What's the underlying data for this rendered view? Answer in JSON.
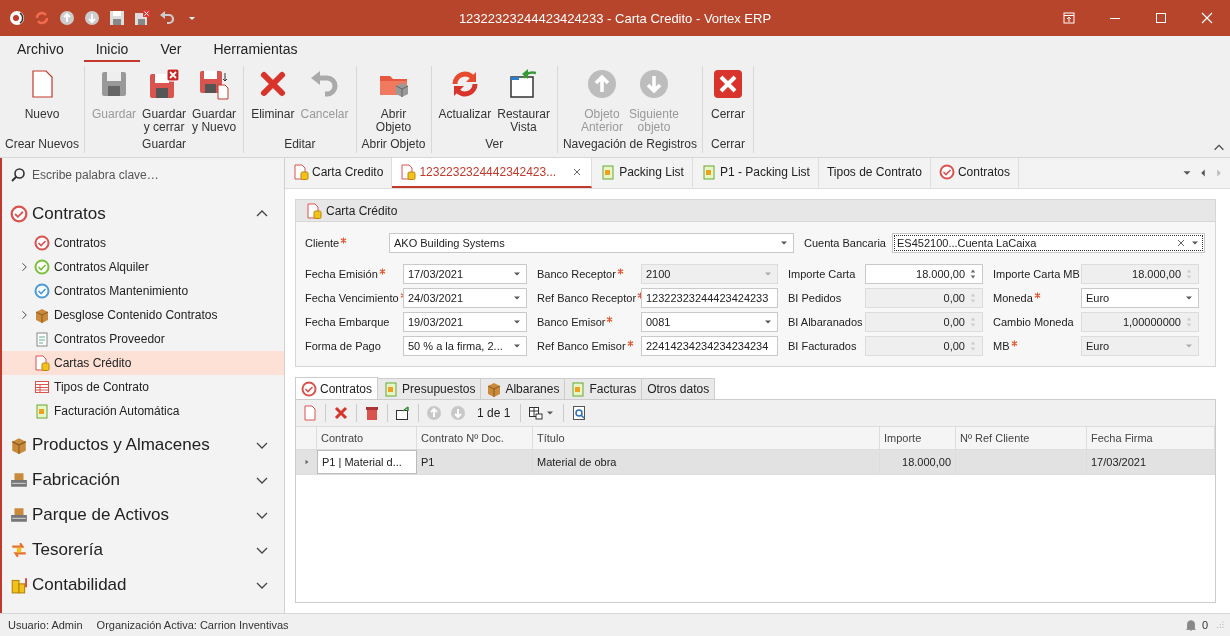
{
  "window": {
    "title": "12322323244423424233 - Carta Credito - Vortex ERP"
  },
  "ribbon": {
    "tabs": [
      {
        "label": "Archivo",
        "selected": false
      },
      {
        "label": "Inicio",
        "selected": true
      },
      {
        "label": "Ver",
        "selected": false
      },
      {
        "label": "Herramientas",
        "selected": false
      }
    ],
    "groups": [
      {
        "label": "Crear Nuevos",
        "buttons": [
          {
            "label": "Nuevo",
            "disabled": false
          }
        ]
      },
      {
        "label": "Guardar",
        "buttons": [
          {
            "label": "Guardar",
            "disabled": true
          },
          {
            "label": "Guardar\ny cerrar",
            "disabled": false
          },
          {
            "label": "Guardar\ny Nuevo",
            "disabled": false
          }
        ]
      },
      {
        "label": "Editar",
        "buttons": [
          {
            "label": "Eliminar",
            "disabled": false
          },
          {
            "label": "Cancelar",
            "disabled": true
          }
        ]
      },
      {
        "label": "Abrir Objeto",
        "buttons": [
          {
            "label": "Abrir\nObjeto",
            "disabled": false
          }
        ]
      },
      {
        "label": "Ver",
        "buttons": [
          {
            "label": "Actualizar",
            "disabled": false
          },
          {
            "label": "Restaurar\nVista",
            "disabled": false
          }
        ]
      },
      {
        "label": "Navegación de Registros",
        "buttons": [
          {
            "label": "Objeto\nAnterior",
            "disabled": true
          },
          {
            "label": "Siguiente\nobjeto",
            "disabled": true
          }
        ]
      },
      {
        "label": "Cerrar",
        "buttons": [
          {
            "label": "Cerrar",
            "disabled": false
          }
        ]
      }
    ]
  },
  "sidebar": {
    "search": {
      "placeholder": "Escribe palabra clave…"
    },
    "sections": [
      {
        "label": "Contratos",
        "expanded": true,
        "items": [
          {
            "label": "Contratos",
            "selected": false,
            "expandable": false
          },
          {
            "label": "Contratos Alquiler",
            "selected": false,
            "expandable": true
          },
          {
            "label": "Contratos Mantenimiento",
            "selected": false,
            "expandable": false
          },
          {
            "label": "Desglose Contenido Contratos",
            "selected": false,
            "expandable": true
          },
          {
            "label": "Contratos Proveedor",
            "selected": false,
            "expandable": false
          },
          {
            "label": "Cartas Crédito",
            "selected": true,
            "expandable": false
          },
          {
            "label": "Tipos de Contrato",
            "selected": false,
            "expandable": false
          },
          {
            "label": "Facturación Automática",
            "selected": false,
            "expandable": false
          }
        ]
      },
      {
        "label": "Productos y Almacenes",
        "expanded": false
      },
      {
        "label": "Fabricación",
        "expanded": false
      },
      {
        "label": "Parque de Activos",
        "expanded": false
      },
      {
        "label": "Tesorería",
        "expanded": false
      },
      {
        "label": "Contabilidad",
        "expanded": false
      }
    ]
  },
  "document_tabs": [
    {
      "label": "Carta Credito",
      "selected": false
    },
    {
      "label": "1232232324442342423...",
      "selected": true
    },
    {
      "label": "Packing List",
      "selected": false
    },
    {
      "label": "P1 - Packing List",
      "selected": false
    },
    {
      "label": "Tipos de Contrato",
      "selected": false
    },
    {
      "label": "Contratos",
      "selected": false
    }
  ],
  "form": {
    "title": "Carta Crédito",
    "top_fields": [
      {
        "label": "Cliente",
        "required": true,
        "value": "AKO Building Systems",
        "kind": "combo",
        "disabled": false,
        "focused": false
      },
      {
        "label": "Cuenta Bancaria",
        "required": false,
        "value": "ES452100...Cuenta LaCaixa",
        "kind": "lookup",
        "disabled": false,
        "focused": true
      }
    ],
    "fields": [
      {
        "label": "Fecha Emisión",
        "required": true,
        "value": "17/03/2021",
        "kind": "combo",
        "disabled": false
      },
      {
        "label": "Banco Receptor",
        "required": true,
        "value": "2100",
        "kind": "combo",
        "disabled": true
      },
      {
        "label": "Importe Carta",
        "required": false,
        "value": "18.000,00",
        "kind": "number",
        "disabled": false
      },
      {
        "label": "Importe Carta MB",
        "required": false,
        "value": "18.000,00",
        "kind": "number",
        "disabled": true
      },
      {
        "label": "Fecha Vencimiento",
        "required": true,
        "value": "24/03/2021",
        "kind": "combo",
        "disabled": false
      },
      {
        "label": "Ref Banco Receptor",
        "required": true,
        "value": "12322323244423424233",
        "kind": "text",
        "disabled": false
      },
      {
        "label": "BI Pedidos",
        "required": false,
        "value": "0,00",
        "kind": "number",
        "disabled": true
      },
      {
        "label": "Moneda",
        "required": true,
        "value": "Euro",
        "kind": "combo",
        "disabled": false
      },
      {
        "label": "Fecha Embarque",
        "required": false,
        "value": "19/03/2021",
        "kind": "combo",
        "disabled": false
      },
      {
        "label": "Banco Emisor",
        "required": true,
        "value": "0081",
        "kind": "combo",
        "disabled": false
      },
      {
        "label": "BI Albaranados",
        "required": false,
        "value": "0,00",
        "kind": "number",
        "disabled": true
      },
      {
        "label": "Cambio Moneda",
        "required": false,
        "value": "1,00000000",
        "kind": "number",
        "disabled": true
      },
      {
        "label": "Forma de Pago",
        "required": false,
        "value": "50 % a la firma, 2...",
        "kind": "combo",
        "disabled": false
      },
      {
        "label": "Ref Banco Emisor",
        "required": true,
        "value": "22414234234234234234",
        "kind": "text",
        "disabled": false
      },
      {
        "label": "BI Facturados",
        "required": false,
        "value": "0,00",
        "kind": "number",
        "disabled": true
      },
      {
        "label": "MB",
        "required": true,
        "value": "Euro",
        "kind": "combo",
        "disabled": true
      }
    ]
  },
  "detail": {
    "tabs": [
      {
        "label": "Contratos",
        "selected": true
      },
      {
        "label": "Presupuestos",
        "selected": false
      },
      {
        "label": "Albaranes",
        "selected": false
      },
      {
        "label": "Facturas",
        "selected": false
      },
      {
        "label": "Otros datos",
        "selected": false
      }
    ],
    "pager": "1 de 1",
    "columns": [
      {
        "label": "Contrato"
      },
      {
        "label": "Contrato Nº Doc."
      },
      {
        "label": "Título"
      },
      {
        "label": "Importe"
      },
      {
        "label": "Nº Ref Cliente"
      },
      {
        "label": "Fecha Firma"
      }
    ],
    "rows": [
      {
        "selected": true,
        "cells": [
          "P1 | Material d...",
          "P1",
          "Material de obra",
          "18.000,00",
          null,
          "17/03/2021"
        ]
      }
    ]
  },
  "status_bar": {
    "user": "Usuario: Admin",
    "organization": "Organización Activa: Carrion Inventivas",
    "notifications": "0"
  }
}
